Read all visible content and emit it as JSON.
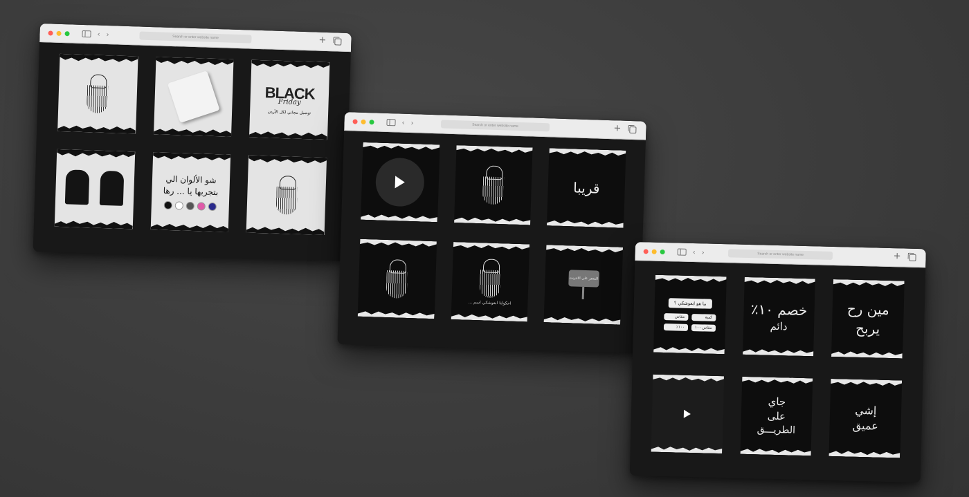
{
  "browser": {
    "address_placeholder": "Search or enter website name",
    "new_tab_icon": "plus-icon",
    "tabs_icon": "tabs-overview-icon"
  },
  "windows": [
    {
      "name": "window-1",
      "tiles": [
        {
          "type": "light",
          "kind": "portrait"
        },
        {
          "type": "light",
          "kind": "paper-cutout"
        },
        {
          "type": "light",
          "kind": "black-friday",
          "title": "BLACK",
          "subtitle": "Friday",
          "caption": "توصيل مجاني لكل الأردن"
        },
        {
          "type": "light",
          "kind": "hoodies"
        },
        {
          "type": "light",
          "kind": "colors",
          "line1": "شو الألوان الي",
          "line2": "بتجربها يا ... رها",
          "colors": [
            "#111111",
            "#ffffff",
            "#555555",
            "#e05aa9",
            "#2a2a8c"
          ]
        },
        {
          "type": "light",
          "kind": "portrait"
        }
      ]
    },
    {
      "name": "window-2",
      "tiles": [
        {
          "type": "dark",
          "kind": "video"
        },
        {
          "type": "dark",
          "kind": "portrait"
        },
        {
          "type": "dark",
          "kind": "soon",
          "text": "قريبا"
        },
        {
          "type": "dark",
          "kind": "portrait"
        },
        {
          "type": "dark",
          "kind": "portrait-caption",
          "caption": "احكولنا ابعوشكي اسم ..."
        },
        {
          "type": "dark",
          "kind": "sign",
          "text": "المتجر على الانترنت"
        }
      ]
    },
    {
      "name": "window-3",
      "tiles": [
        {
          "type": "dark",
          "kind": "faq",
          "title": "ما هو ابعوشكي ؟",
          "pills": [
            "مقاس",
            "كمية",
            "١٠٠٪",
            "مقاس ١٠٠"
          ]
        },
        {
          "type": "dark",
          "kind": "big-text",
          "line1": "خصم ١٠٪",
          "line2": "دائم"
        },
        {
          "type": "dark",
          "kind": "big-text",
          "line1": "مين رح",
          "line2": "يربح"
        },
        {
          "type": "dark",
          "kind": "video-small"
        },
        {
          "type": "dark",
          "kind": "big-text",
          "line1": "جاي",
          "line2": "على",
          "line3": "الطريـــق"
        },
        {
          "type": "dark",
          "kind": "big-text",
          "line1": "إشي",
          "line2": "عميق"
        }
      ]
    }
  ]
}
